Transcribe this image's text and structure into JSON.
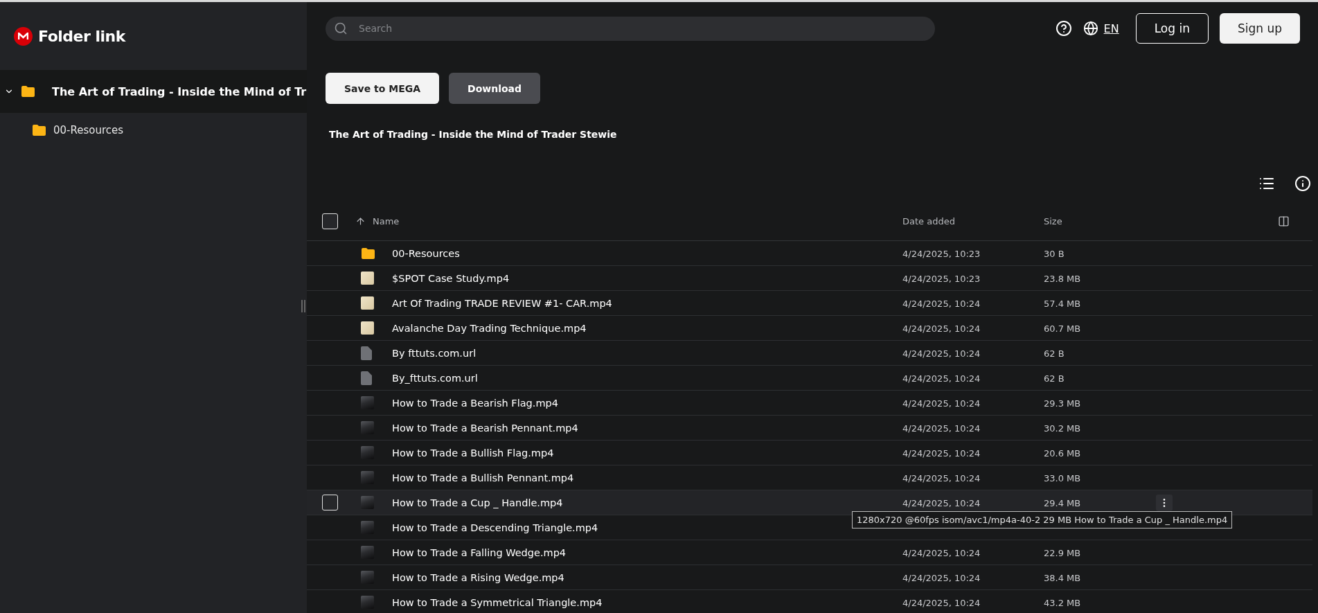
{
  "brand": {
    "title": "Folder link"
  },
  "sidebar": {
    "tree": [
      {
        "label": "The Art of Trading - Inside the Mind of Tr",
        "expanded": true,
        "selected": true,
        "children": [
          {
            "label": "00-Resources",
            "selected": false
          }
        ]
      }
    ]
  },
  "topbar": {
    "search": {
      "placeholder": "Search"
    },
    "language": "EN",
    "buttons": [
      {
        "label": "Log in",
        "kind": "outline"
      },
      {
        "label": "Sign up",
        "kind": "filled"
      }
    ]
  },
  "actions": [
    {
      "label": "Save to MEGA",
      "kind": "light"
    },
    {
      "label": "Download",
      "kind": "dark"
    }
  ],
  "folder_title": "The Art of Trading - Inside the Mind of Trader Stewie",
  "table": {
    "select_all_checked": false,
    "columns": [
      "Name",
      "Date added",
      "Size"
    ],
    "rows": [
      {
        "kind": "folder",
        "name": "00-Resources",
        "date": "4/24/2025, 10:23",
        "size": "30 B",
        "hovered": false
      },
      {
        "kind": "clip",
        "name": "$SPOT Case Study.mp4",
        "date": "4/24/2025, 10:23",
        "size": "23.8 MB",
        "hovered": false
      },
      {
        "kind": "clip",
        "name": "Art Of Trading TRADE REVIEW #1- CAR.mp4",
        "date": "4/24/2025, 10:24",
        "size": "57.4 MB",
        "hovered": false
      },
      {
        "kind": "clip",
        "name": "Avalanche Day Trading Technique.mp4",
        "date": "4/24/2025, 10:24",
        "size": "60.7 MB",
        "hovered": false
      },
      {
        "kind": "file",
        "name": "By fttuts.com.url",
        "date": "4/24/2025, 10:24",
        "size": "62 B",
        "hovered": false
      },
      {
        "kind": "file",
        "name": "By_fttuts.com.url",
        "date": "4/24/2025, 10:24",
        "size": "62 B",
        "hovered": false
      },
      {
        "kind": "video",
        "name": "How to Trade a Bearish Flag.mp4",
        "date": "4/24/2025, 10:24",
        "size": "29.3 MB",
        "hovered": false
      },
      {
        "kind": "video",
        "name": "How to Trade a Bearish Pennant.mp4",
        "date": "4/24/2025, 10:24",
        "size": "30.2 MB",
        "hovered": false
      },
      {
        "kind": "video",
        "name": "How to Trade a Bullish Flag.mp4",
        "date": "4/24/2025, 10:24",
        "size": "20.6 MB",
        "hovered": false
      },
      {
        "kind": "video",
        "name": "How to Trade a Bullish Pennant.mp4",
        "date": "4/24/2025, 10:24",
        "size": "33.0 MB",
        "hovered": false
      },
      {
        "kind": "video",
        "name": "How to Trade a Cup _ Handle.mp4",
        "date": "4/24/2025, 10:24",
        "size": "29.4 MB",
        "hovered": true,
        "tooltip": "1280x720 @60fps isom/avc1/mp4a-40-2 29 MB How to Trade a Cup _ Handle.mp4"
      },
      {
        "kind": "video",
        "name": "How to Trade a Descending Triangle.mp4",
        "hovered": false
      },
      {
        "kind": "video",
        "name": "How to Trade a Falling Wedge.mp4",
        "date": "4/24/2025, 10:24",
        "size": "22.9 MB",
        "hovered": false
      },
      {
        "kind": "video",
        "name": "How to Trade a Rising Wedge.mp4",
        "date": "4/24/2025, 10:24",
        "size": "38.4 MB",
        "hovered": false
      },
      {
        "kind": "video",
        "name": "How to Trade a Symmetrical Triangle.mp4",
        "date": "4/24/2025, 10:24",
        "size": "43.2 MB",
        "hovered": false
      }
    ]
  }
}
